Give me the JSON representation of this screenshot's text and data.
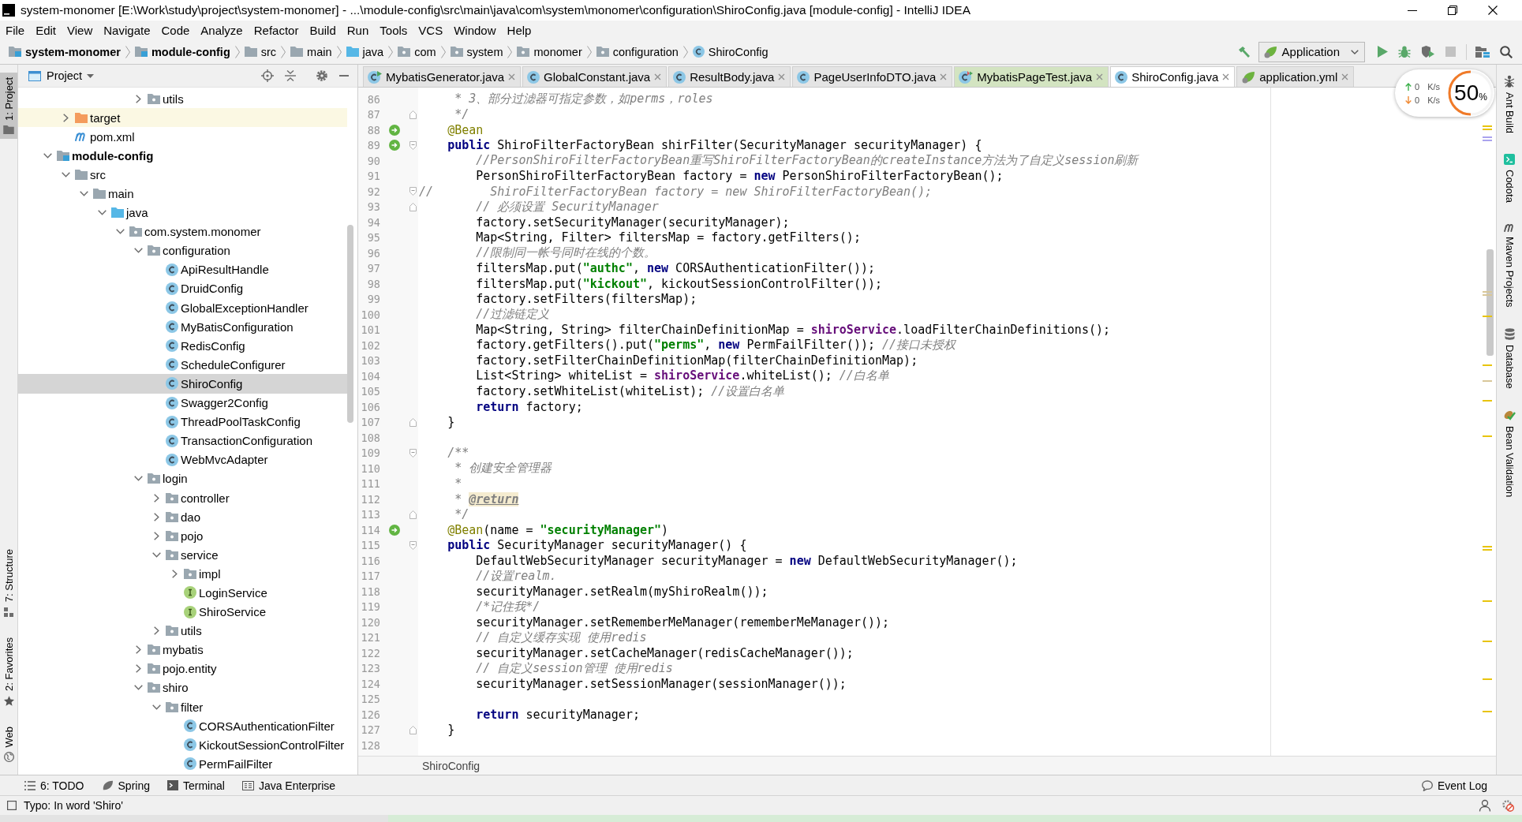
{
  "window": {
    "title": "system-monomer [E:\\Work\\study\\project\\system-monomer] - ...\\module-config\\src\\main\\java\\com\\system\\monomer\\configuration\\ShiroConfig.java [module-config] - IntelliJ IDEA"
  },
  "menu": [
    "File",
    "Edit",
    "View",
    "Navigate",
    "Code",
    "Analyze",
    "Refactor",
    "Build",
    "Run",
    "Tools",
    "VCS",
    "Window",
    "Help"
  ],
  "nav_bar": {
    "breadcrumbs": [
      {
        "label": "system-monomer",
        "kind": "module"
      },
      {
        "label": "module-config",
        "kind": "module"
      },
      {
        "label": "src",
        "kind": "folder"
      },
      {
        "label": "main",
        "kind": "folder"
      },
      {
        "label": "java",
        "kind": "source-folder"
      },
      {
        "label": "com",
        "kind": "package"
      },
      {
        "label": "system",
        "kind": "package"
      },
      {
        "label": "monomer",
        "kind": "package"
      },
      {
        "label": "configuration",
        "kind": "package"
      },
      {
        "label": "ShiroConfig",
        "kind": "class"
      }
    ],
    "run_configuration": "Application"
  },
  "tool_windows_left": [
    {
      "label": "1: Project",
      "kind": "project",
      "selected": true
    },
    {
      "label": "7: Structure",
      "kind": "structure",
      "selected": false
    },
    {
      "label": "2: Favorites",
      "kind": "favorites",
      "selected": false
    },
    {
      "label": "Web",
      "kind": "web",
      "selected": false
    }
  ],
  "project_panel": {
    "title": "Project",
    "tree": [
      {
        "children": [
          {
            "children": [
              {
                "children": [
                  {
                    "children": [
                      {
                        "children": [
                          {
                            "label": "utils",
                            "kind": "package",
                            "expanded": false,
                            "selected": false
                          }
                        ]
                      }
                    ]
                  }
                ]
              }
            ]
          },
          {
            "label": "target",
            "kind": "excluded-folder",
            "expanded": false,
            "selected": false
          },
          {
            "label": "pom.xml",
            "kind": "maven-file",
            "selected": false
          }
        ]
      },
      {
        "label": "module-config",
        "kind": "module",
        "expanded": true,
        "selected": false,
        "children": [
          {
            "label": "src",
            "kind": "folder",
            "expanded": true,
            "selected": false,
            "children": [
              {
                "label": "main",
                "kind": "folder",
                "expanded": true,
                "selected": false,
                "children": [
                  {
                    "label": "java",
                    "kind": "source-folder",
                    "expanded": true,
                    "selected": false,
                    "children": [
                      {
                        "label": "com.system.monomer",
                        "kind": "package",
                        "expanded": true,
                        "selected": false,
                        "children": [
                          {
                            "label": "configuration",
                            "kind": "package",
                            "expanded": true,
                            "selected": false,
                            "children": [
                              {
                                "label": "ApiResultHandle",
                                "kind": "class",
                                "selected": false
                              },
                              {
                                "label": "DruidConfig",
                                "kind": "class",
                                "selected": false
                              },
                              {
                                "label": "GlobalExceptionHandler",
                                "kind": "class",
                                "selected": false
                              },
                              {
                                "label": "MyBatisConfiguration",
                                "kind": "class",
                                "selected": false
                              },
                              {
                                "label": "RedisConfig",
                                "kind": "class",
                                "selected": false
                              },
                              {
                                "label": "ScheduleConfigurer",
                                "kind": "class",
                                "selected": false
                              },
                              {
                                "label": "ShiroConfig",
                                "kind": "class",
                                "selected": true
                              },
                              {
                                "label": "Swagger2Config",
                                "kind": "class",
                                "selected": false
                              },
                              {
                                "label": "ThreadPoolTaskConfig",
                                "kind": "class",
                                "selected": false
                              },
                              {
                                "label": "TransactionConfiguration",
                                "kind": "class",
                                "selected": false
                              },
                              {
                                "label": "WebMvcAdapter",
                                "kind": "class",
                                "selected": false
                              }
                            ]
                          },
                          {
                            "label": "login",
                            "kind": "package",
                            "expanded": true,
                            "selected": false,
                            "children": [
                              {
                                "label": "controller",
                                "kind": "package",
                                "expanded": false,
                                "selected": false
                              },
                              {
                                "label": "dao",
                                "kind": "package",
                                "expanded": false,
                                "selected": false
                              },
                              {
                                "label": "pojo",
                                "kind": "package",
                                "expanded": false,
                                "selected": false
                              },
                              {
                                "label": "service",
                                "kind": "package",
                                "expanded": true,
                                "selected": false,
                                "children": [
                                  {
                                    "label": "impl",
                                    "kind": "package",
                                    "expanded": false,
                                    "selected": false
                                  },
                                  {
                                    "label": "LoginService",
                                    "kind": "interface",
                                    "selected": false
                                  },
                                  {
                                    "label": "ShiroService",
                                    "kind": "interface",
                                    "selected": false
                                  }
                                ]
                              },
                              {
                                "label": "utils",
                                "kind": "package",
                                "expanded": false,
                                "selected": false
                              }
                            ]
                          },
                          {
                            "label": "mybatis",
                            "kind": "package",
                            "expanded": false,
                            "selected": false
                          },
                          {
                            "label": "pojo.entity",
                            "kind": "package",
                            "expanded": false,
                            "selected": false
                          },
                          {
                            "label": "shiro",
                            "kind": "package",
                            "expanded": true,
                            "selected": false,
                            "children": [
                              {
                                "label": "filter",
                                "kind": "package",
                                "expanded": true,
                                "selected": false,
                                "children": [
                                  {
                                    "label": "CORSAuthenticationFilter",
                                    "kind": "class",
                                    "selected": false
                                  },
                                  {
                                    "label": "KickoutSessionControlFilter",
                                    "kind": "class",
                                    "selected": false
                                  },
                                  {
                                    "label": "PermFailFilter",
                                    "kind": "class",
                                    "selected": false
                                  }
                                ]
                              }
                            ]
                          }
                        ]
                      }
                    ]
                  }
                ]
              }
            ]
          }
        ]
      }
    ]
  },
  "editor": {
    "tabs": [
      {
        "label": "MybatisGenerator.java",
        "kind": "main-class",
        "selected": false
      },
      {
        "label": "GlobalConstant.java",
        "kind": "class",
        "selected": false
      },
      {
        "label": "ResultBody.java",
        "kind": "class",
        "selected": false
      },
      {
        "label": "PageUserInfoDTO.java",
        "kind": "class",
        "selected": false
      },
      {
        "label": "MybatisPageTest.java",
        "kind": "test-class",
        "selected": false
      },
      {
        "label": "ShiroConfig.java",
        "kind": "class",
        "selected": true
      },
      {
        "label": "application.yml",
        "kind": "spring-config",
        "selected": false
      }
    ],
    "lines": [
      {
        "number": "86",
        "bean": false,
        "fold_start": false,
        "fold_end": false,
        "segments": [
          {
            "kind": "comment",
            "text": "     * 3、部分过滤器可指定参数，如perms，roles"
          }
        ]
      },
      {
        "number": "87",
        "bean": false,
        "fold_start": false,
        "fold_end": true,
        "segments": [
          {
            "kind": "comment",
            "text": "     */"
          }
        ]
      },
      {
        "number": "88",
        "bean": true,
        "fold_start": false,
        "fold_end": false,
        "segments": [
          {
            "kind": "annotation",
            "text": "    @Bean"
          }
        ]
      },
      {
        "number": "89",
        "bean": true,
        "fold_start": true,
        "fold_end": false,
        "segments": [
          {
            "kind": "keyword",
            "text": "    public"
          },
          {
            "kind": "plain",
            "text": " ShiroFilterFactoryBean shirFilter(SecurityManager securityManager) {"
          }
        ]
      },
      {
        "number": "90",
        "bean": false,
        "fold_start": false,
        "fold_end": false,
        "segments": [
          {
            "kind": "comment",
            "text": "        //PersonShiroFilterFactoryBean重写ShiroFilterFactoryBean的createInstance方法为了自定义session刷新"
          }
        ]
      },
      {
        "number": "91",
        "bean": false,
        "fold_start": false,
        "fold_end": false,
        "segments": [
          {
            "kind": "plain",
            "text": "        PersonShiroFilterFactoryBean factory = "
          },
          {
            "kind": "keyword",
            "text": "new"
          },
          {
            "kind": "plain",
            "text": " PersonShiroFilterFactoryBean();"
          }
        ]
      },
      {
        "number": "92",
        "bean": false,
        "fold_start": true,
        "fold_end": false,
        "segments": [
          {
            "kind": "comment",
            "text": "//        ShiroFilterFactoryBean factory = new ShiroFilterFactoryBean();"
          }
        ]
      },
      {
        "number": "93",
        "bean": false,
        "fold_start": false,
        "fold_end": true,
        "segments": [
          {
            "kind": "comment",
            "text": "        // 必须设置 SecurityManager"
          }
        ]
      },
      {
        "number": "94",
        "bean": false,
        "fold_start": false,
        "fold_end": false,
        "segments": [
          {
            "kind": "plain",
            "text": "        factory.setSecurityManager(securityManager);"
          }
        ]
      },
      {
        "number": "95",
        "bean": false,
        "fold_start": false,
        "fold_end": false,
        "segments": [
          {
            "kind": "plain",
            "text": "        Map<String, Filter> filtersMap = factory.getFilters();"
          }
        ]
      },
      {
        "number": "96",
        "bean": false,
        "fold_start": false,
        "fold_end": false,
        "segments": [
          {
            "kind": "comment",
            "text": "        //限制同一帐号同时在线的个数。"
          }
        ]
      },
      {
        "number": "97",
        "bean": false,
        "fold_start": false,
        "fold_end": false,
        "segments": [
          {
            "kind": "plain",
            "text": "        filtersMap.put("
          },
          {
            "kind": "string",
            "text": "\"authc\""
          },
          {
            "kind": "plain",
            "text": ", "
          },
          {
            "kind": "keyword",
            "text": "new"
          },
          {
            "kind": "plain",
            "text": " CORSAuthenticationFilter());"
          }
        ]
      },
      {
        "number": "98",
        "bean": false,
        "fold_start": false,
        "fold_end": false,
        "segments": [
          {
            "kind": "plain",
            "text": "        filtersMap.put("
          },
          {
            "kind": "string",
            "text": "\"kickout\""
          },
          {
            "kind": "plain",
            "text": ", kickoutSessionControlFilter());"
          }
        ]
      },
      {
        "number": "99",
        "bean": false,
        "fold_start": false,
        "fold_end": false,
        "segments": [
          {
            "kind": "plain",
            "text": "        factory.setFilters(filtersMap);"
          }
        ]
      },
      {
        "number": "100",
        "bean": false,
        "fold_start": false,
        "fold_end": false,
        "segments": [
          {
            "kind": "comment",
            "text": "        //过滤链定义"
          }
        ]
      },
      {
        "number": "101",
        "bean": false,
        "fold_start": false,
        "fold_end": false,
        "segments": [
          {
            "kind": "plain",
            "text": "        Map<String, String> filterChainDefinitionMap = "
          },
          {
            "kind": "field",
            "text": "shiroService"
          },
          {
            "kind": "plain",
            "text": ".loadFilterChainDefinitions();"
          }
        ]
      },
      {
        "number": "102",
        "bean": false,
        "fold_start": false,
        "fold_end": false,
        "segments": [
          {
            "kind": "plain",
            "text": "        factory.getFilters().put("
          },
          {
            "kind": "string",
            "text": "\"perms\""
          },
          {
            "kind": "plain",
            "text": ", "
          },
          {
            "kind": "keyword",
            "text": "new"
          },
          {
            "kind": "plain",
            "text": " PermFailFilter()); "
          },
          {
            "kind": "comment",
            "text": "//接口未授权"
          }
        ]
      },
      {
        "number": "103",
        "bean": false,
        "fold_start": false,
        "fold_end": false,
        "segments": [
          {
            "kind": "plain",
            "text": "        factory.setFilterChainDefinitionMap(filterChainDefinitionMap);"
          }
        ]
      },
      {
        "number": "104",
        "bean": false,
        "fold_start": false,
        "fold_end": false,
        "segments": [
          {
            "kind": "plain",
            "text": "        List<String> whiteList = "
          },
          {
            "kind": "field",
            "text": "shiroService"
          },
          {
            "kind": "plain",
            "text": ".whiteList(); "
          },
          {
            "kind": "comment",
            "text": "//白名单"
          }
        ]
      },
      {
        "number": "105",
        "bean": false,
        "fold_start": false,
        "fold_end": false,
        "segments": [
          {
            "kind": "plain",
            "text": "        factory.setWhiteList(whiteList); "
          },
          {
            "kind": "comment",
            "text": "//设置白名单"
          }
        ]
      },
      {
        "number": "106",
        "bean": false,
        "fold_start": false,
        "fold_end": false,
        "segments": [
          {
            "kind": "keyword",
            "text": "        return"
          },
          {
            "kind": "plain",
            "text": " factory;"
          }
        ]
      },
      {
        "number": "107",
        "bean": false,
        "fold_start": false,
        "fold_end": true,
        "segments": [
          {
            "kind": "plain",
            "text": "    }"
          }
        ]
      },
      {
        "number": "108",
        "bean": false,
        "fold_start": false,
        "fold_end": false
      },
      {
        "number": "109",
        "bean": false,
        "fold_start": true,
        "fold_end": false,
        "segments": [
          {
            "kind": "comment",
            "text": "    /**"
          }
        ]
      },
      {
        "number": "110",
        "bean": false,
        "fold_start": false,
        "fold_end": false,
        "segments": [
          {
            "kind": "comment",
            "text": "     * 创建安全管理器"
          }
        ]
      },
      {
        "number": "111",
        "bean": false,
        "fold_start": false,
        "fold_end": false,
        "segments": [
          {
            "kind": "comment",
            "text": "     *"
          }
        ]
      },
      {
        "number": "112",
        "bean": false,
        "fold_start": false,
        "fold_end": false,
        "segments": [
          {
            "kind": "comment",
            "text": "     * "
          },
          {
            "kind": "doc-tag",
            "text": "@return"
          }
        ]
      },
      {
        "number": "113",
        "bean": false,
        "fold_start": false,
        "fold_end": true,
        "segments": [
          {
            "kind": "comment",
            "text": "     */"
          }
        ]
      },
      {
        "number": "114",
        "bean": true,
        "fold_start": false,
        "fold_end": false,
        "segments": [
          {
            "kind": "annotation",
            "text": "    @Bean"
          },
          {
            "kind": "plain",
            "text": "(name = "
          },
          {
            "kind": "string",
            "text": "\"securityManager\""
          },
          {
            "kind": "plain",
            "text": ")"
          }
        ]
      },
      {
        "number": "115",
        "bean": false,
        "fold_start": true,
        "fold_end": false,
        "segments": [
          {
            "kind": "keyword",
            "text": "    public"
          },
          {
            "kind": "plain",
            "text": " SecurityManager securityManager() {"
          }
        ]
      },
      {
        "number": "116",
        "bean": false,
        "fold_start": false,
        "fold_end": false,
        "segments": [
          {
            "kind": "plain",
            "text": "        DefaultWebSecurityManager securityManager = "
          },
          {
            "kind": "keyword",
            "text": "new"
          },
          {
            "kind": "plain",
            "text": " DefaultWebSecurityManager();"
          }
        ]
      },
      {
        "number": "117",
        "bean": false,
        "fold_start": false,
        "fold_end": false,
        "segments": [
          {
            "kind": "comment",
            "text": "        //设置realm."
          }
        ]
      },
      {
        "number": "118",
        "bean": false,
        "fold_start": false,
        "fold_end": false,
        "segments": [
          {
            "kind": "plain",
            "text": "        securityManager.setRealm(myShiroRealm());"
          }
        ]
      },
      {
        "number": "119",
        "bean": false,
        "fold_start": false,
        "fold_end": false,
        "segments": [
          {
            "kind": "comment",
            "text": "        /*记住我*/"
          }
        ]
      },
      {
        "number": "120",
        "bean": false,
        "fold_start": false,
        "fold_end": false,
        "segments": [
          {
            "kind": "plain",
            "text": "        securityManager.setRememberMeManager(rememberMeManager());"
          }
        ]
      },
      {
        "number": "121",
        "bean": false,
        "fold_start": false,
        "fold_end": false,
        "segments": [
          {
            "kind": "comment",
            "text": "        // 自定义缓存实现 使用redis"
          }
        ]
      },
      {
        "number": "122",
        "bean": false,
        "fold_start": false,
        "fold_end": false,
        "segments": [
          {
            "kind": "plain",
            "text": "        securityManager.setCacheManager(redisCacheManager());"
          }
        ]
      },
      {
        "number": "123",
        "bean": false,
        "fold_start": false,
        "fold_end": false,
        "segments": [
          {
            "kind": "comment",
            "text": "        // 自定义session管理 使用redis"
          }
        ]
      },
      {
        "number": "124",
        "bean": false,
        "fold_start": false,
        "fold_end": false,
        "segments": [
          {
            "kind": "plain",
            "text": "        securityManager.setSessionManager(sessionManager());"
          }
        ]
      },
      {
        "number": "125",
        "bean": false,
        "fold_start": false,
        "fold_end": false
      },
      {
        "number": "126",
        "bean": false,
        "fold_start": false,
        "fold_end": false,
        "segments": [
          {
            "kind": "keyword",
            "text": "        return"
          },
          {
            "kind": "plain",
            "text": " securityManager;"
          }
        ]
      },
      {
        "number": "127",
        "bean": false,
        "fold_start": false,
        "fold_end": true,
        "segments": [
          {
            "kind": "plain",
            "text": "    }"
          }
        ]
      },
      {
        "number": "128",
        "bean": false,
        "fold_start": false,
        "fold_end": false
      }
    ],
    "breadcrumb": "ShiroConfig"
  },
  "tool_windows_right": [
    {
      "label": "Ant Build",
      "kind": "ant",
      "selected": false
    },
    {
      "label": "Codota",
      "kind": "codota",
      "selected": false
    },
    {
      "label": "Maven Projects",
      "kind": "maven",
      "selected": false
    },
    {
      "label": "Database",
      "kind": "database",
      "selected": false
    },
    {
      "label": "Bean Validation",
      "kind": "bean-validation",
      "selected": false
    }
  ],
  "tool_windows_bottom": [
    {
      "label": "6: TODO",
      "kind": "todo",
      "selected": false
    },
    {
      "label": "Spring",
      "kind": "spring",
      "selected": false
    },
    {
      "label": "Terminal",
      "kind": "terminal",
      "selected": false
    },
    {
      "label": "Java Enterprise",
      "kind": "java-enterprise",
      "selected": false
    },
    {
      "label": "Event Log",
      "kind": "event-log",
      "selected": false
    }
  ],
  "status_bar": {
    "message": "Typo: In word 'Shiro'"
  },
  "speed_widget": {
    "upload": {
      "value": "0",
      "unit": "K/s"
    },
    "download": {
      "value": "0",
      "unit": "K/s"
    },
    "load": {
      "value": "50",
      "unit": "%",
      "level": 0.5
    }
  }
}
